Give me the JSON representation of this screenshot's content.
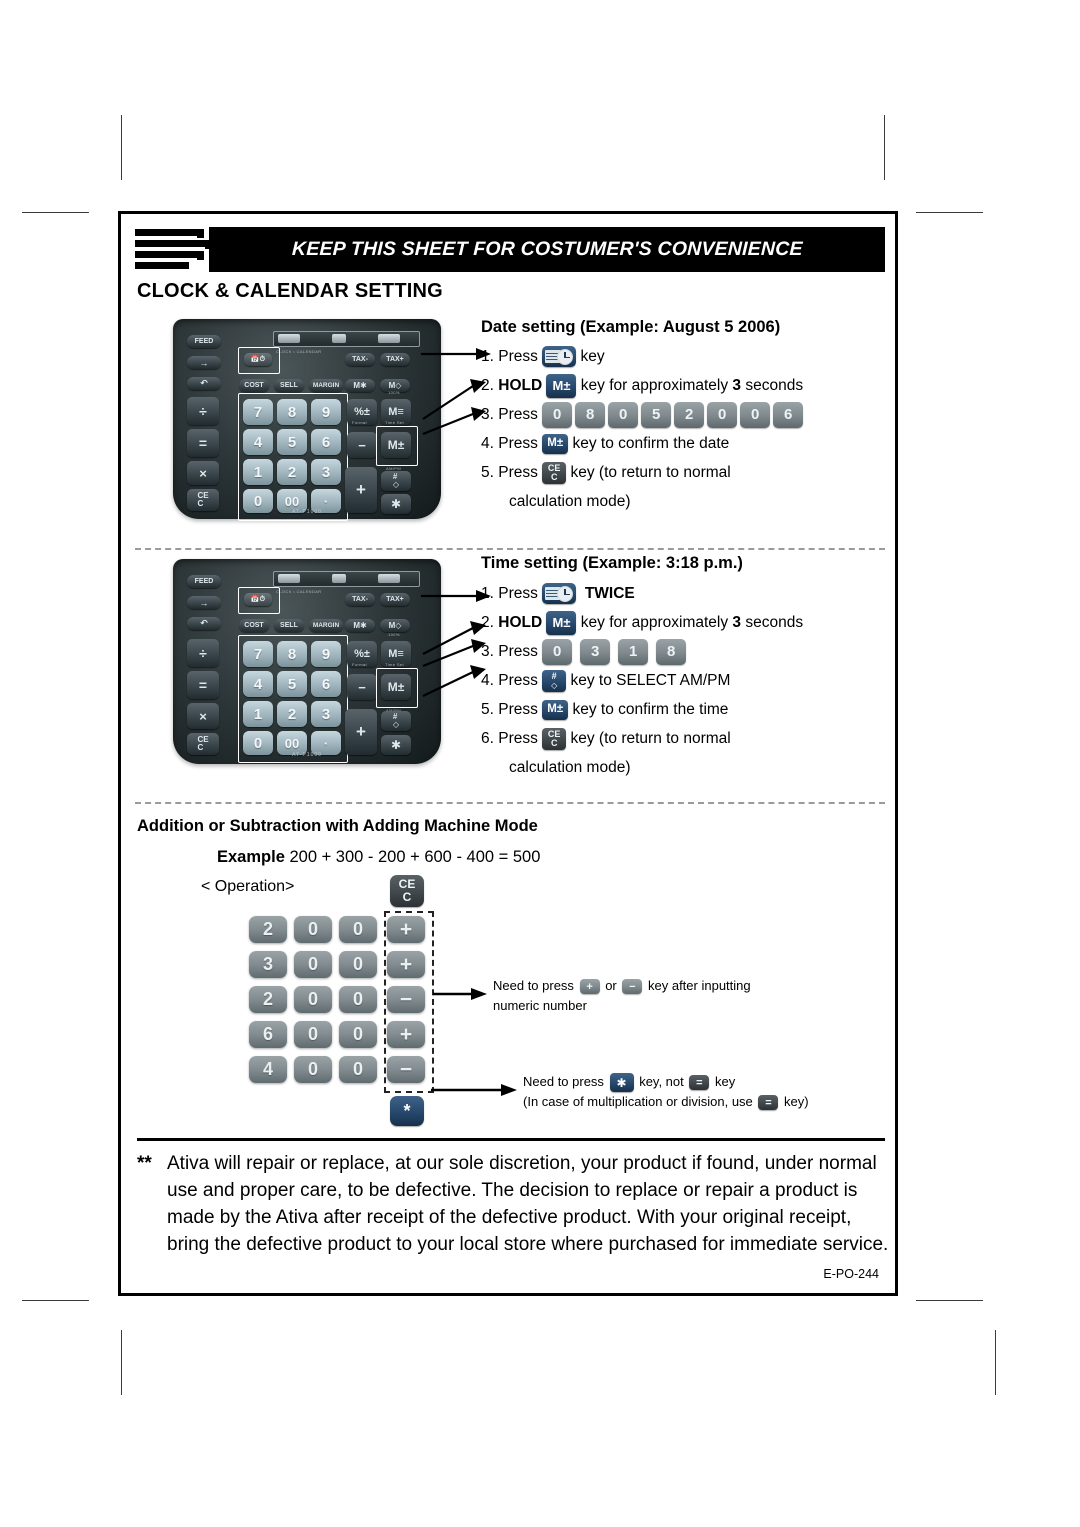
{
  "banner": {
    "title": "KEEP THIS SHEET FOR COSTUMER'S CONVENIENCE"
  },
  "clock_section": {
    "title": "CLOCK & CALENDAR SETTING"
  },
  "date_setting": {
    "title": "Date setting (Example: August 5 2006)",
    "steps": [
      {
        "no": "1.",
        "verb": "Press",
        "key": "clock-calendar-key",
        "tail": "key"
      },
      {
        "no": "2.",
        "verb": "HOLD",
        "key": "m-plus-minus-key",
        "tail": "key for approximately",
        "emphasis": "3",
        "tail2": "seconds"
      },
      {
        "no": "3.",
        "verb": "Press",
        "digits": [
          "0",
          "8",
          "0",
          "5",
          "2",
          "0",
          "0",
          "6"
        ]
      },
      {
        "no": "4.",
        "verb": "Press",
        "key": "m-plus-minus-key",
        "tail": "key to confirm the date"
      },
      {
        "no": "5.",
        "verb": "Press",
        "key": "ce-c-key",
        "tail": "key (to return to normal"
      },
      {
        "no": "",
        "cont": "calculation mode)"
      }
    ]
  },
  "time_setting": {
    "title": "Time setting (Example: 3:18 p.m.)",
    "steps": [
      {
        "no": "1.",
        "verb": "Press",
        "key": "clock-calendar-key",
        "tail_bold": "TWICE"
      },
      {
        "no": "2.",
        "verb": "HOLD",
        "key": "m-plus-minus-key",
        "tail": "key for approximately",
        "emphasis": "3",
        "tail2": "seconds"
      },
      {
        "no": "3.",
        "verb": "Press",
        "digits": [
          "0",
          "3",
          "1",
          "8"
        ]
      },
      {
        "no": "4.",
        "verb": "Press",
        "key": "hash-diamond-key",
        "tail": "key to SELECT AM/PM"
      },
      {
        "no": "5.",
        "verb": "Press",
        "key": "m-plus-minus-key",
        "tail": "key to confirm the time"
      },
      {
        "no": "6.",
        "verb": "Press",
        "key": "ce-c-key",
        "tail": "key (to return to normal"
      },
      {
        "no": "",
        "cont": "calculation mode)"
      }
    ]
  },
  "adding_machine": {
    "title": "Addition or Subtraction with Adding Machine Mode",
    "example_label": "Example",
    "example_expression": "200 + 300 - 200 + 600 - 400 = 500",
    "operation_label": "< Operation>",
    "clear_key": "CE/C",
    "rows": [
      {
        "digits": [
          "2",
          "0",
          "0"
        ],
        "op": "+"
      },
      {
        "digits": [
          "3",
          "0",
          "0"
        ],
        "op": "+"
      },
      {
        "digits": [
          "2",
          "0",
          "0"
        ],
        "op": "−"
      },
      {
        "digits": [
          "6",
          "0",
          "0"
        ],
        "op": "+"
      },
      {
        "digits": [
          "4",
          "0",
          "0"
        ],
        "op": "−"
      }
    ],
    "total_key": "*",
    "note1_line1_a": "Need to press",
    "note1_or": "or",
    "note1_line1_b": "key after inputting",
    "note1_line2": "numeric number",
    "note2_line1_a": "Need to press",
    "note2_line1_b": "key, not",
    "note2_line1_c": "key",
    "note2_line2_a": "(In case of multiplication or division, use",
    "note2_line2_b": "key)"
  },
  "warranty": {
    "marker": "**",
    "text": "Ativa will repair or replace, at our sole discretion, your product if found, under normal use and proper care, to be defective. The decision to replace or repair a product is made by the Ativa after receipt of the defective product. With your original receipt, bring the defective product to your local store where purchased for immediate service.",
    "code": "E-PO-244"
  },
  "calculator": {
    "model": "AT-P1000",
    "clock_calendar_caption": "CLOCK • CALENDAR",
    "function_keys": [
      "FEED",
      "→",
      "↺"
    ],
    "left_column": [
      "÷",
      "=",
      "×",
      "CE/C"
    ],
    "top_row": [
      "COST",
      "SELL",
      "MARGIN"
    ],
    "tax_keys": [
      "TAX-",
      "TAX+"
    ],
    "memory_keys": [
      "M∗",
      "M◇"
    ],
    "right_column": [
      "%±",
      "M≡",
      "−",
      "M±",
      "#◇",
      "∗"
    ],
    "numpad": [
      "7",
      "8",
      "9",
      "4",
      "5",
      "6",
      "1",
      "2",
      "3",
      "0",
      "00",
      "·"
    ],
    "plus_key": "+",
    "micro_time_set": "Time Set",
    "micro_am_pm": "AM/PM",
    "micro_format": "Format",
    "micro_100": "100%"
  },
  "colors": {
    "banner_bg": "#000000",
    "key_blue": "#27486c",
    "key_gray": "#7e888c",
    "key_dark": "#41484c",
    "paper": "#ffffff"
  }
}
